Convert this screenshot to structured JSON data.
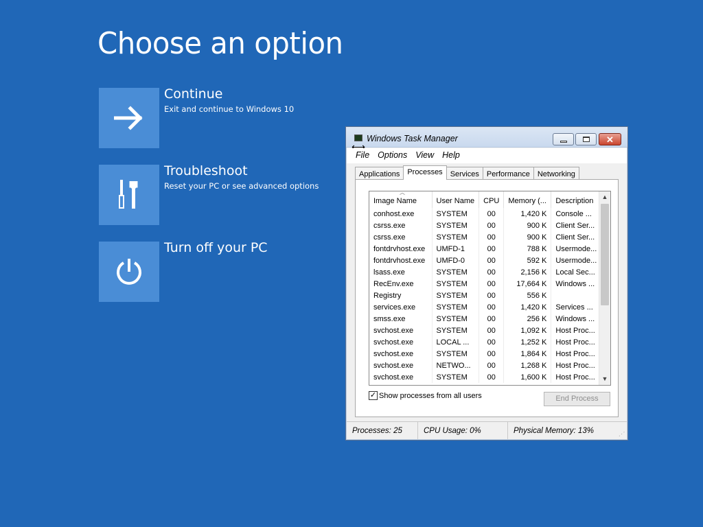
{
  "screen": {
    "title": "Choose an option",
    "options": [
      {
        "title": "Continue",
        "subtitle": "Exit and continue to Windows 10",
        "icon": "arrow-right-icon"
      },
      {
        "title": "Troubleshoot",
        "subtitle": "Reset your PC or see advanced options",
        "icon": "tools-icon"
      },
      {
        "title": "Turn off your PC",
        "subtitle": "",
        "icon": "power-icon"
      }
    ]
  },
  "task_manager": {
    "title": "Windows Task Manager",
    "menu": [
      "File",
      "Options",
      "View",
      "Help"
    ],
    "tabs": [
      "Applications",
      "Processes",
      "Services",
      "Performance",
      "Networking"
    ],
    "active_tab": "Processes",
    "columns": [
      "Image Name",
      "User Name",
      "CPU",
      "Memory (...",
      "Description"
    ],
    "rows": [
      [
        "conhost.exe",
        "SYSTEM",
        "00",
        "1,420 K",
        "Console ..."
      ],
      [
        "csrss.exe",
        "SYSTEM",
        "00",
        "900 K",
        "Client Ser..."
      ],
      [
        "csrss.exe",
        "SYSTEM",
        "00",
        "900 K",
        "Client Ser..."
      ],
      [
        "fontdrvhost.exe",
        "UMFD-1",
        "00",
        "788 K",
        "Usermode..."
      ],
      [
        "fontdrvhost.exe",
        "UMFD-0",
        "00",
        "592 K",
        "Usermode..."
      ],
      [
        "lsass.exe",
        "SYSTEM",
        "00",
        "2,156 K",
        "Local Sec..."
      ],
      [
        "RecEnv.exe",
        "SYSTEM",
        "00",
        "17,664 K",
        "Windows ..."
      ],
      [
        "Registry",
        "SYSTEM",
        "00",
        "556 K",
        ""
      ],
      [
        "services.exe",
        "SYSTEM",
        "00",
        "1,420 K",
        "Services ..."
      ],
      [
        "smss.exe",
        "SYSTEM",
        "00",
        "256 K",
        "Windows ..."
      ],
      [
        "svchost.exe",
        "SYSTEM",
        "00",
        "1,092 K",
        "Host Proc..."
      ],
      [
        "svchost.exe",
        "LOCAL ...",
        "00",
        "1,252 K",
        "Host Proc..."
      ],
      [
        "svchost.exe",
        "SYSTEM",
        "00",
        "1,864 K",
        "Host Proc..."
      ],
      [
        "svchost.exe",
        "NETWO...",
        "00",
        "1,268 K",
        "Host Proc..."
      ],
      [
        "svchost.exe",
        "SYSTEM",
        "00",
        "1,600 K",
        "Host Proc..."
      ]
    ],
    "show_all_label": "Show processes from all users",
    "show_all_checked": true,
    "end_process_label": "End Process",
    "status": {
      "processes": "Processes: 25",
      "cpu": "CPU Usage: 0%",
      "memory": "Physical Memory: 13%"
    }
  },
  "colors": {
    "background": "#2067b7",
    "tile": "#4a8dd6",
    "close_button": "#c9452e"
  }
}
